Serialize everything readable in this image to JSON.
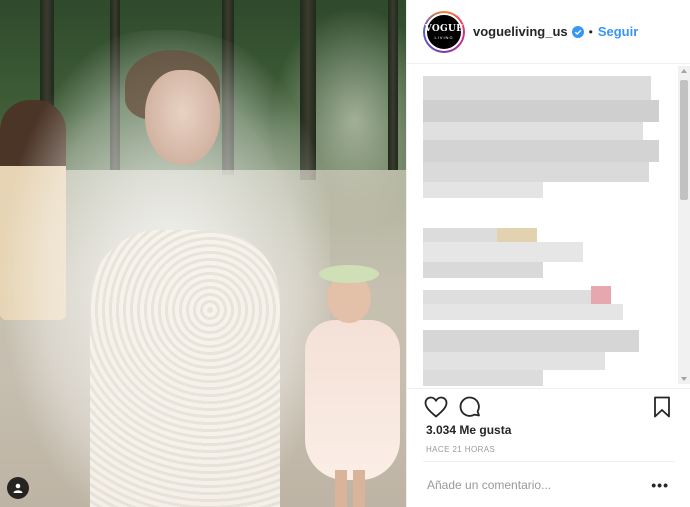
{
  "post": {
    "username": "vogueliving_us",
    "follow_label": "Seguir",
    "separator": "•",
    "avatar_text_main": "VOGUE",
    "avatar_text_sub": "LIVING",
    "likes": "3.034 Me gusta",
    "time_ago": "HACE 21 HORAS",
    "comment_placeholder": "Añade un comentario...",
    "more_label": "•••"
  },
  "icons": {
    "verified": "verified-badge-icon",
    "like": "heart-icon",
    "comment": "comment-icon",
    "save": "bookmark-icon",
    "tag": "user-tag-icon"
  },
  "colors": {
    "follow": "#3897f0",
    "verified": "#3897f0",
    "text": "#262626",
    "muted": "#999999"
  }
}
